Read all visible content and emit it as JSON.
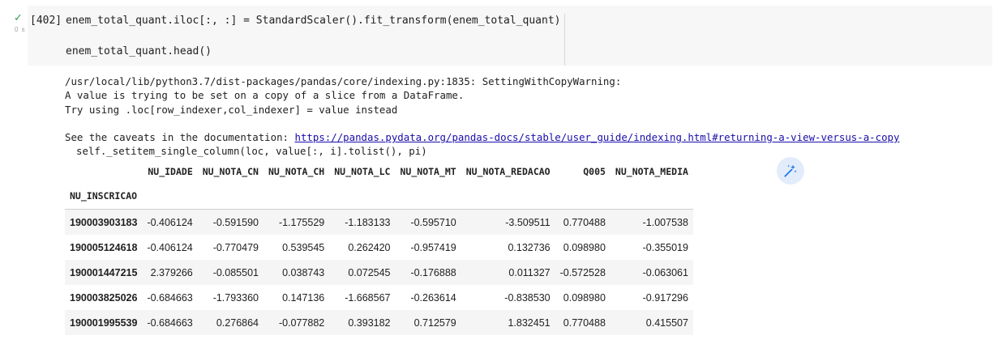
{
  "cell": {
    "exec_time": "0 s",
    "exec_count": "[402]",
    "code_line_1": "enem_total_quant.iloc[:, :] = StandardScaler().fit_transform(enem_total_quant)",
    "code_line_2": "enem_total_quant.head()"
  },
  "output": {
    "warning_line_1": "/usr/local/lib/python3.7/dist-packages/pandas/core/indexing.py:1835: SettingWithCopyWarning:",
    "warning_line_2": "A value is trying to be set on a copy of a slice from a DataFrame.",
    "warning_line_3": "Try using .loc[row_indexer,col_indexer] = value instead",
    "caveats_prefix": "See the caveats in the documentation: ",
    "caveats_link": "https://pandas.pydata.org/pandas-docs/stable/user_guide/indexing.html#returning-a-view-versus-a-copy",
    "setitem_line": "self._setitem_single_column(loc, value[:, i].tolist(), pi)"
  },
  "table": {
    "columns": [
      "NU_IDADE",
      "NU_NOTA_CN",
      "NU_NOTA_CH",
      "NU_NOTA_LC",
      "NU_NOTA_MT",
      "NU_NOTA_REDACAO",
      "Q005",
      "NU_NOTA_MEDIA"
    ],
    "index_name": "NU_INSCRICAO",
    "rows": [
      {
        "index": "190003903183",
        "values": [
          "-0.406124",
          "-0.591590",
          "-1.175529",
          "-1.183133",
          "-0.595710",
          "-3.509511",
          "0.770488",
          "-1.007538"
        ]
      },
      {
        "index": "190005124618",
        "values": [
          "-0.406124",
          "-0.770479",
          "0.539545",
          "0.262420",
          "-0.957419",
          "0.132736",
          "0.098980",
          "-0.355019"
        ]
      },
      {
        "index": "190001447215",
        "values": [
          "2.379266",
          "-0.085501",
          "0.038743",
          "0.072545",
          "-0.176888",
          "0.011327",
          "-0.572528",
          "-0.063061"
        ]
      },
      {
        "index": "190003825026",
        "values": [
          "-0.684663",
          "-1.793360",
          "0.147136",
          "-1.668567",
          "-0.263614",
          "-0.838530",
          "0.098980",
          "-0.917296"
        ]
      },
      {
        "index": "190001995539",
        "values": [
          "-0.684663",
          "0.276864",
          "-0.077882",
          "0.393182",
          "0.712579",
          "1.832451",
          "0.770488",
          "0.415507"
        ]
      }
    ]
  },
  "icons": {
    "run_status": "check-icon",
    "magic": "magic-wand-icon",
    "colors": {
      "check": "#2e9e4d",
      "magic": "#1a73e8",
      "magic_bg": "#e3ecfa",
      "link": "#1a0dab"
    }
  }
}
